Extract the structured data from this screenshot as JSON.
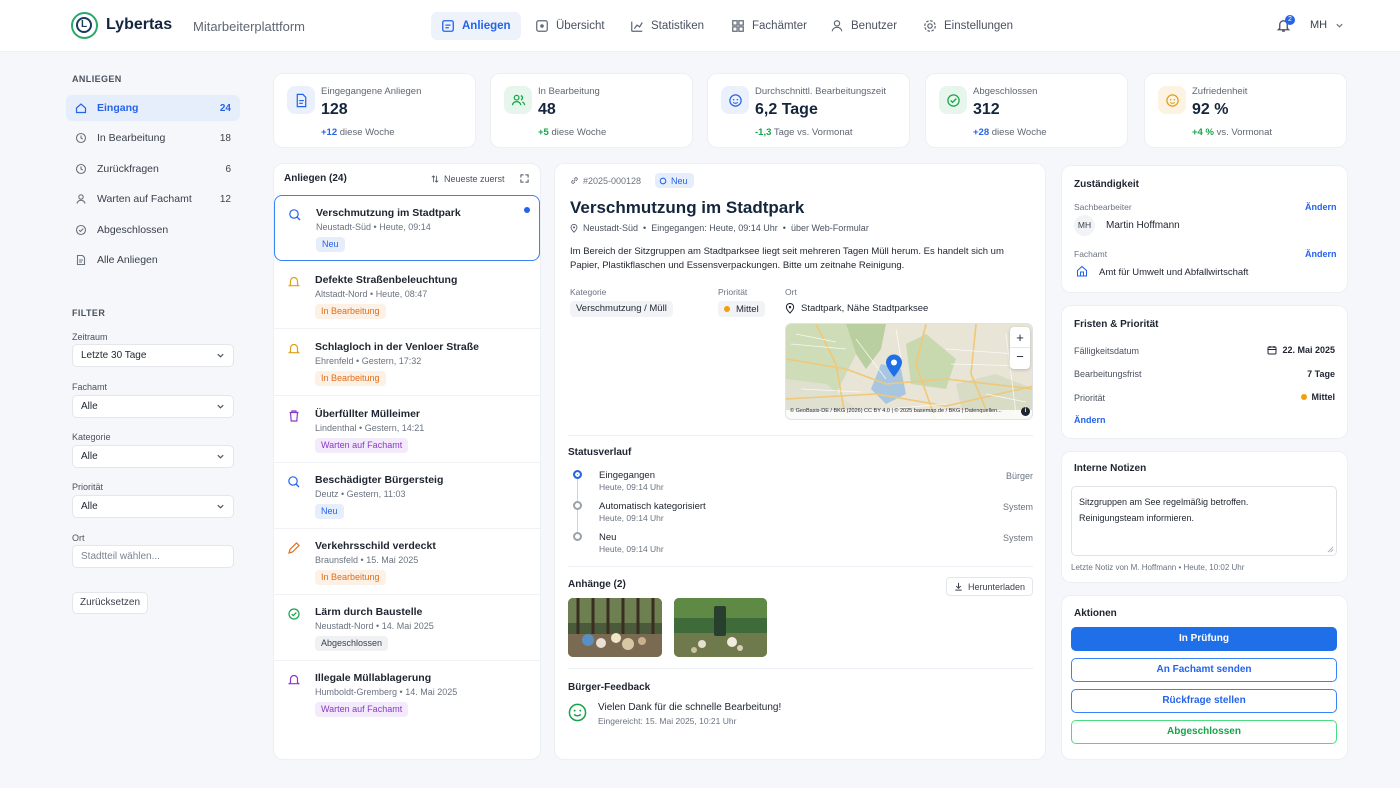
{
  "app": {
    "brand": "Lybertas",
    "logo_letter": "L",
    "platform": "Mitarbeiterplattform",
    "notif_count": "2",
    "user_initials": "MH"
  },
  "nav": [
    {
      "label": "Anliegen",
      "icon": "inbox-icon"
    },
    {
      "label": "Übersicht",
      "icon": "overview-icon"
    },
    {
      "label": "Statistiken",
      "icon": "chart-icon"
    },
    {
      "label": "Fachämter",
      "icon": "grid-icon"
    },
    {
      "label": "Benutzer",
      "icon": "user-icon"
    },
    {
      "label": "Einstellungen",
      "icon": "gear-icon"
    }
  ],
  "sidebar": {
    "heading": "ANLIEGEN",
    "items": [
      {
        "label": "Eingang",
        "count": "24"
      },
      {
        "label": "In Bearbeitung",
        "count": "18"
      },
      {
        "label": "Zurückfragen",
        "count": "6"
      },
      {
        "label": "Warten auf Fachamt",
        "count": "12"
      },
      {
        "label": "Abgeschlossen",
        "count": ""
      },
      {
        "label": "Alle Anliegen",
        "count": ""
      }
    ],
    "filter_heading": "FILTER",
    "filters": [
      {
        "label": "Zeitraum",
        "value": "Letzte 30 Tage"
      },
      {
        "label": "Fachamt",
        "value": "Alle"
      },
      {
        "label": "Kategorie",
        "value": "Alle"
      },
      {
        "label": "Priorität",
        "value": "Alle"
      }
    ],
    "ort_label": "Ort",
    "ort_placeholder": "Stadtteil wählen...",
    "reset": "Zurücksetzen"
  },
  "stats": [
    {
      "label": "Eingegangene Anliegen",
      "value": "128",
      "delta": "+12",
      "suffix": "diese Woche",
      "color": "#2563eb"
    },
    {
      "label": "In Bearbeitung",
      "value": "48",
      "delta": "+5",
      "suffix": "diese Woche",
      "color": "#16a34a"
    },
    {
      "label": "Durchschnittl. Bearbeitungszeit",
      "value": "6,2 Tage",
      "delta": "-1,3",
      "suffix": "Tage vs. Vormonat",
      "color": "#16a34a"
    },
    {
      "label": "Abgeschlossen",
      "value": "312",
      "delta": "+28",
      "suffix": "diese Woche",
      "color": "#2563eb"
    },
    {
      "label": "Zufriedenheit",
      "value": "92 %",
      "delta": "+4 %",
      "suffix": "vs. Vormonat",
      "color": "#16a34a"
    }
  ],
  "list": {
    "title": "Anliegen (24)",
    "sort": "Neueste zuerst",
    "items": [
      {
        "title": "Verschmutzung im Stadtpark",
        "district": "Neustadt-Süd",
        "time": "Heute, 09:14",
        "badge": "Neu"
      },
      {
        "title": "Defekte Straßenbeleuchtung",
        "district": "Altstadt-Nord",
        "time": "Heute, 08:47",
        "badge": "In Bearbeitung"
      },
      {
        "title": "Schlagloch in der Venloer Straße",
        "district": "Ehrenfeld",
        "time": "Gestern, 17:32",
        "badge": "In Bearbeitung"
      },
      {
        "title": "Überfüllter Mülleimer",
        "district": "Lindenthal",
        "time": "Gestern, 14:21",
        "badge": "Warten auf Fachamt"
      },
      {
        "title": "Beschädigter Bürgersteig",
        "district": "Deutz",
        "time": "Gestern, 11:03",
        "badge": "Neu"
      },
      {
        "title": "Verkehrsschild verdeckt",
        "district": "Braunsfeld",
        "time": "15. Mai 2025",
        "badge": "In Bearbeitung"
      },
      {
        "title": "Lärm durch Baustelle",
        "district": "Neustadt-Nord",
        "time": "14. Mai 2025",
        "badge": "Abgeschlossen"
      },
      {
        "title": "Illegale Müllablagerung",
        "district": "Humboldt-Gremberg",
        "time": "14. Mai 2025",
        "badge": "Warten auf Fachamt"
      }
    ]
  },
  "detail": {
    "id": "#2025-000128",
    "status": "Neu",
    "title": "Verschmutzung im Stadtpark",
    "district": "Neustadt-Süd",
    "received": "Eingegangen: Heute, 09:14 Uhr",
    "channel": "über Web-Formular",
    "description": "Im Bereich der Sitzgruppen am Stadtparksee liegt seit mehreren Tagen Müll herum. Es handelt sich um Papier, Plastikflaschen und Essensverpackungen. Bitte um zeitnahe Reinigung.",
    "category_label": "Kategorie",
    "category": "Verschmutzung / Müll",
    "priority_label": "Priorität",
    "priority": "Mittel",
    "location_label": "Ort",
    "location": "Stadtpark, Nähe Stadtparksee",
    "map_attribution": "© GeoBasis-DE / BKG (2026) CC BY 4.0 | © 2025 basemap.de / BKG | Datenquellen...",
    "history_title": "Statusverlauf",
    "history": [
      {
        "name": "Eingegangen",
        "time": "Heute, 09:14 Uhr",
        "source": "Bürger"
      },
      {
        "name": "Automatisch kategorisiert",
        "time": "Heute, 09:14 Uhr",
        "source": "System"
      },
      {
        "name": "Neu",
        "time": "Heute, 09:14 Uhr",
        "source": "System"
      }
    ],
    "attachments_title": "Anhänge (2)",
    "download": "Herunterladen",
    "feedback_title": "Bürger-Feedback",
    "feedback_text": "Vielen Dank für die schnelle Bearbeitung!",
    "feedback_time": "Eingereicht: 15. Mai 2025, 10:21 Uhr"
  },
  "right": {
    "resp_title": "Zuständigkeit",
    "clerk_label": "Sachbearbeiter",
    "change": "Ändern",
    "clerk_initials": "MH",
    "clerk_name": "Martin Hoffmann",
    "office_label": "Fachamt",
    "office": "Amt für Umwelt und Abfallwirtschaft",
    "deadlines_title": "Fristen & Priorität",
    "due_label": "Fälligkeitsdatum",
    "due": "22. Mai 2025",
    "period_label": "Bearbeitungsfrist",
    "period": "7 Tage",
    "prio_label": "Priorität",
    "prio": "Mittel",
    "notes_title": "Interne Notizen",
    "notes_text": "Sitzgruppen am See regelmäßig betroffen.\nReinigungsteam informieren.",
    "notes_meta": "Letzte Notiz von M. Hoffmann • Heute, 10:02 Uhr",
    "actions_title": "Aktionen",
    "actions": [
      "In Prüfung",
      "An Fachamt senden",
      "Rückfrage stellen",
      "Abgeschlossen"
    ]
  }
}
